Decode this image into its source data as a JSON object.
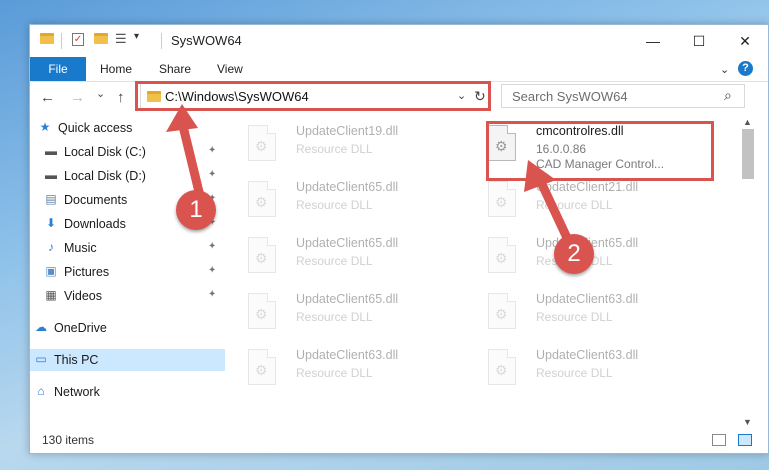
{
  "window": {
    "title": "SysWOW64",
    "minimize": "—",
    "maximize": "☐",
    "close": "✕"
  },
  "ribbon": {
    "tabs": [
      "File",
      "Home",
      "Share",
      "View"
    ],
    "collapse": "⌄",
    "help": "?"
  },
  "nav": {
    "back": "←",
    "forward": "→",
    "recent": "⌄",
    "up": "↑"
  },
  "address": {
    "path": "C:\\Windows\\SysWOW64",
    "dropdown": "⌄",
    "refresh": "↻"
  },
  "search": {
    "placeholder": "Search SysWOW64",
    "icon": "🔍"
  },
  "sidebar": {
    "items": [
      {
        "label": "Quick access",
        "icon": "star-icon",
        "glyph": "★",
        "color": "#2f7fd1",
        "pinned": false
      },
      {
        "label": "Local Disk (C:)",
        "icon": "drive-icon",
        "glyph": "▬",
        "color": "#555555",
        "pinned": true
      },
      {
        "label": "Local Disk (D:)",
        "icon": "drive-icon",
        "glyph": "▬",
        "color": "#555555",
        "pinned": true
      },
      {
        "label": "Documents",
        "icon": "document-icon",
        "glyph": "▤",
        "color": "#5a7fa6",
        "pinned": true
      },
      {
        "label": "Downloads",
        "icon": "download-icon",
        "glyph": "⬇",
        "color": "#2f7fd1",
        "pinned": true
      },
      {
        "label": "Music",
        "icon": "music-icon",
        "glyph": "♪",
        "color": "#2f7fd1",
        "pinned": true
      },
      {
        "label": "Pictures",
        "icon": "picture-icon",
        "glyph": "▣",
        "color": "#5a8fc6",
        "pinned": true
      },
      {
        "label": "Videos",
        "icon": "video-icon",
        "glyph": "▦",
        "color": "#555555",
        "pinned": true
      },
      {
        "label": "OneDrive",
        "icon": "cloud-icon",
        "glyph": "☁",
        "color": "#2f7fd1",
        "pinned": false
      },
      {
        "label": "This PC",
        "icon": "computer-icon",
        "glyph": "▭",
        "color": "#2f7fd1",
        "pinned": false
      },
      {
        "label": "Network",
        "icon": "network-icon",
        "glyph": "⌂",
        "color": "#2f7fd1",
        "pinned": false
      }
    ],
    "pin_glyph": "📌"
  },
  "files": {
    "left": [
      {
        "name": "UpdateClient19.dll",
        "desc": "Resource DLL"
      },
      {
        "name": "UpdateClient65.dll",
        "desc": "Resource DLL"
      },
      {
        "name": "UpdateClient65.dll",
        "desc": "Resource DLL"
      },
      {
        "name": "UpdateClient65.dll",
        "desc": "Resource DLL"
      },
      {
        "name": "UpdateClient63.dll",
        "desc": "Resource DLL"
      }
    ],
    "right": [
      {
        "name": "cmcontrolres.dll",
        "desc": "16.0.0.86",
        "desc2": "CAD Manager Control..."
      },
      {
        "name": "UpdateClient21.dll",
        "desc": "Resource DLL"
      },
      {
        "name": "UpdateClient65.dll",
        "desc": "Resource DLL"
      },
      {
        "name": "UpdateClient63.dll",
        "desc": "Resource DLL"
      },
      {
        "name": "UpdateClient63.dll",
        "desc": "Resource DLL"
      }
    ]
  },
  "status": {
    "count": "130 items"
  },
  "annotations": {
    "callout1": "1",
    "callout2": "2",
    "color": "#d9534f"
  }
}
